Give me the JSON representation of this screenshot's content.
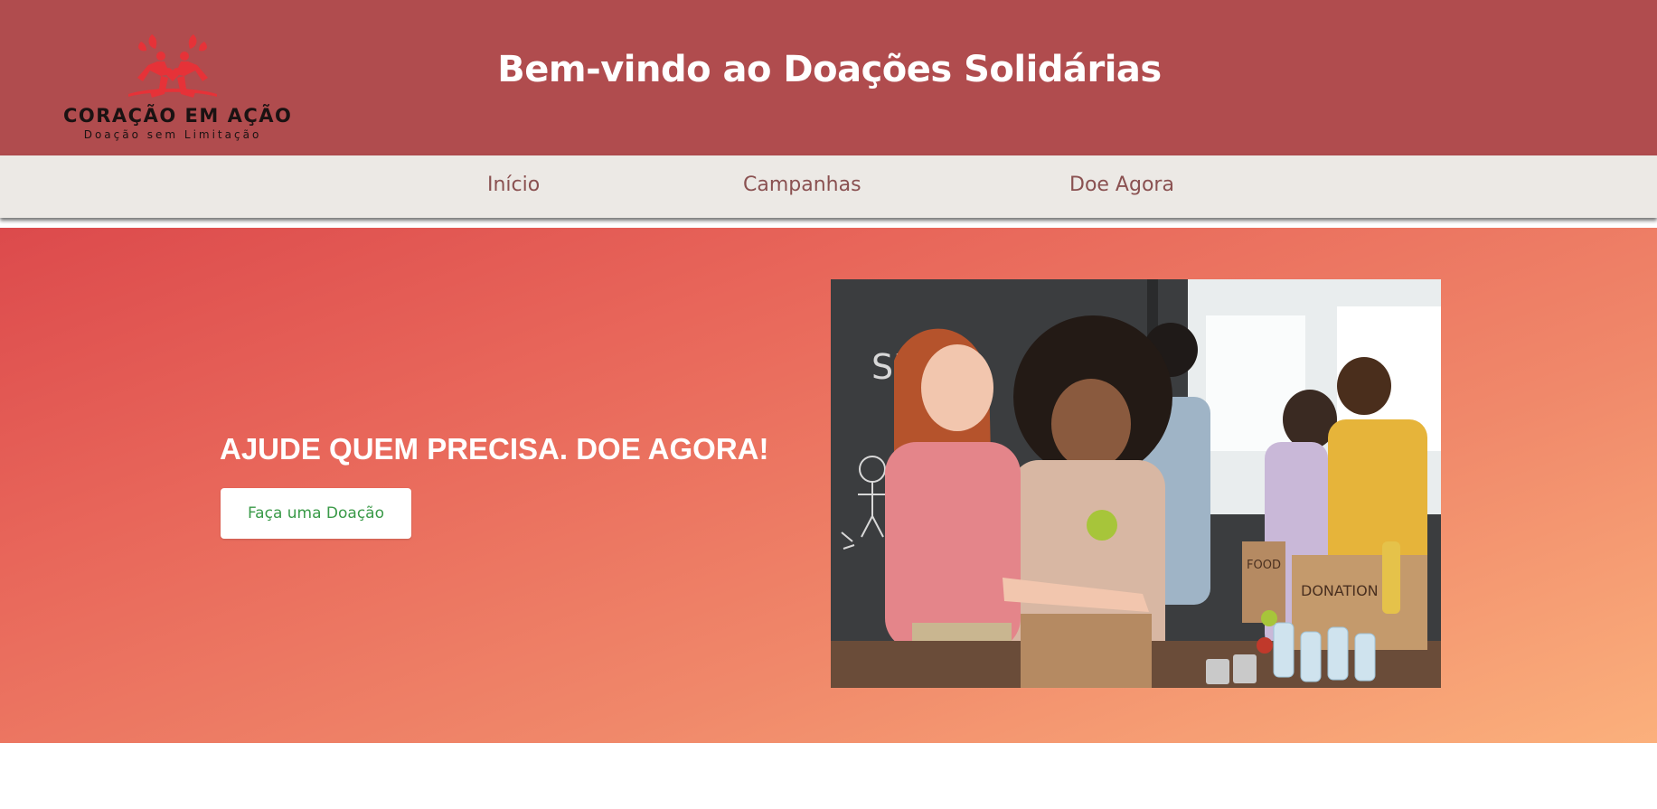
{
  "header": {
    "logo": {
      "name": "CORAÇÃO EM AÇÃO",
      "tagline": "Doação sem Limitação",
      "icon": "two-people-heart-logo-icon",
      "color": "#e63238"
    },
    "title": "Bem-vindo ao Doações Solidárias",
    "background": "#b04c4e"
  },
  "nav": {
    "items": [
      {
        "label": "Início"
      },
      {
        "label": "Campanhas"
      },
      {
        "label": "Doe Agora"
      }
    ],
    "background": "#ece9e5",
    "text_color": "#8a5151"
  },
  "hero": {
    "heading": "AJUDE QUEM PRECISA. DOE AGORA!",
    "button_label": "Faça uma Doação",
    "button_text_color": "#3a9a48",
    "gradient": [
      "#dc4a4c",
      "#fbb07c"
    ],
    "photo": {
      "chalkboard_text": "SHA",
      "box_label": "DONATION",
      "bag_label": "FOOD"
    }
  }
}
